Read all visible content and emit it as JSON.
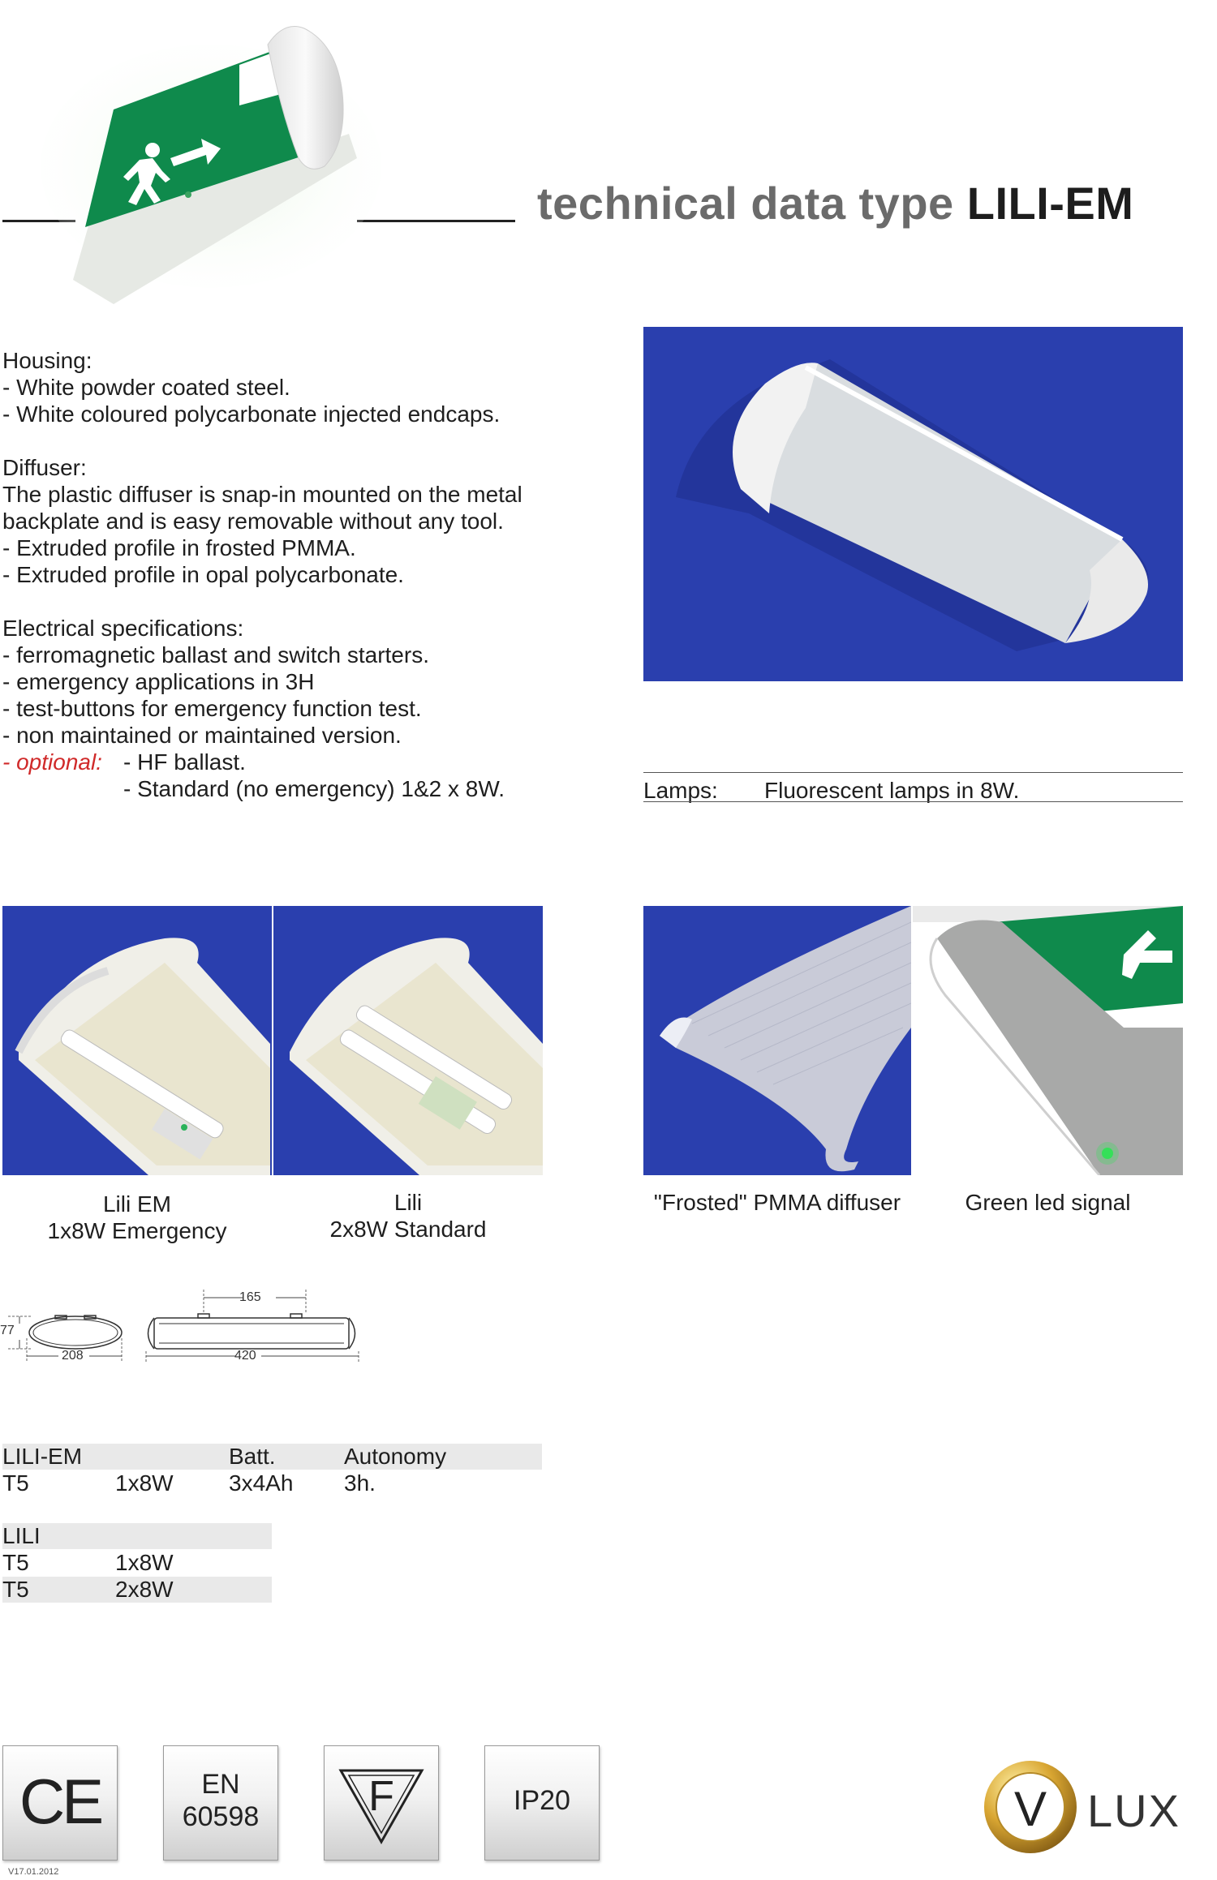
{
  "header": {
    "title_prefix": "technical data type ",
    "title_model": "LILI-EM"
  },
  "product_image": {
    "sign_label": "exit-sign",
    "arrow_icon": "arrow-right-icon"
  },
  "specs": {
    "housing_heading": "Housing:",
    "housing_1": "- White powder coated steel.",
    "housing_2": "- White coloured polycarbonate injected endcaps.",
    "diffuser_heading": "Diffuser:",
    "diffuser_1": "The plastic diffuser is snap-in mounted on the metal",
    "diffuser_2": "backplate and is easy removable without any tool.",
    "diffuser_3": "- Extruded profile in frosted PMMA.",
    "diffuser_4": "- Extruded profile in opal polycarbonate.",
    "electrical_heading": "Electrical specifications:",
    "electrical_1": "- ferromagnetic ballast and switch starters.",
    "electrical_2": "- emergency applications in 3H",
    "electrical_3": "- test-buttons for emergency function test.",
    "electrical_4": "- non maintained or maintained version.",
    "optional_label": "- optional:",
    "optional_1": "- HF ballast.",
    "optional_2": "- Standard (no emergency) 1&2 x 8W."
  },
  "lamps": {
    "label": "Lamps:",
    "value": "Fluorescent lamps in 8W."
  },
  "gallery": {
    "cap1_line1": "Lili EM",
    "cap1_line2": "1x8W Emergency",
    "cap2_line1": "Lili",
    "cap2_line2": "2x8W Standard",
    "cap3": "\"Frosted\" PMMA diffuser",
    "cap4": "Green led signal"
  },
  "dimensions": {
    "height": "77",
    "width_end": "208",
    "mount": "165",
    "length": "420"
  },
  "table_em": {
    "h1": "LILI-EM",
    "h2": "Batt.",
    "h3": "Autonomy",
    "r1c1": "T5",
    "r1c2": "1x8W",
    "r1c3": "3x4Ah",
    "r1c4": "3h."
  },
  "table_lili": {
    "h1": "LILI",
    "r1c1": "T5",
    "r1c2": "1x8W",
    "r2c1": "T5",
    "r2c2": "2x8W"
  },
  "certs": {
    "ce": "CE",
    "en1": "EN",
    "en2": "60598",
    "f": "F",
    "ip": "IP20"
  },
  "brand": {
    "letter": "V",
    "name": "LUX"
  },
  "footer": {
    "version": "V17.01.2012"
  },
  "colors": {
    "blue_bg": "#2a3fae",
    "exit_green": "#0f8a4c",
    "red_italic": "#d02a2a",
    "title_grey": "#6b6b6b"
  }
}
